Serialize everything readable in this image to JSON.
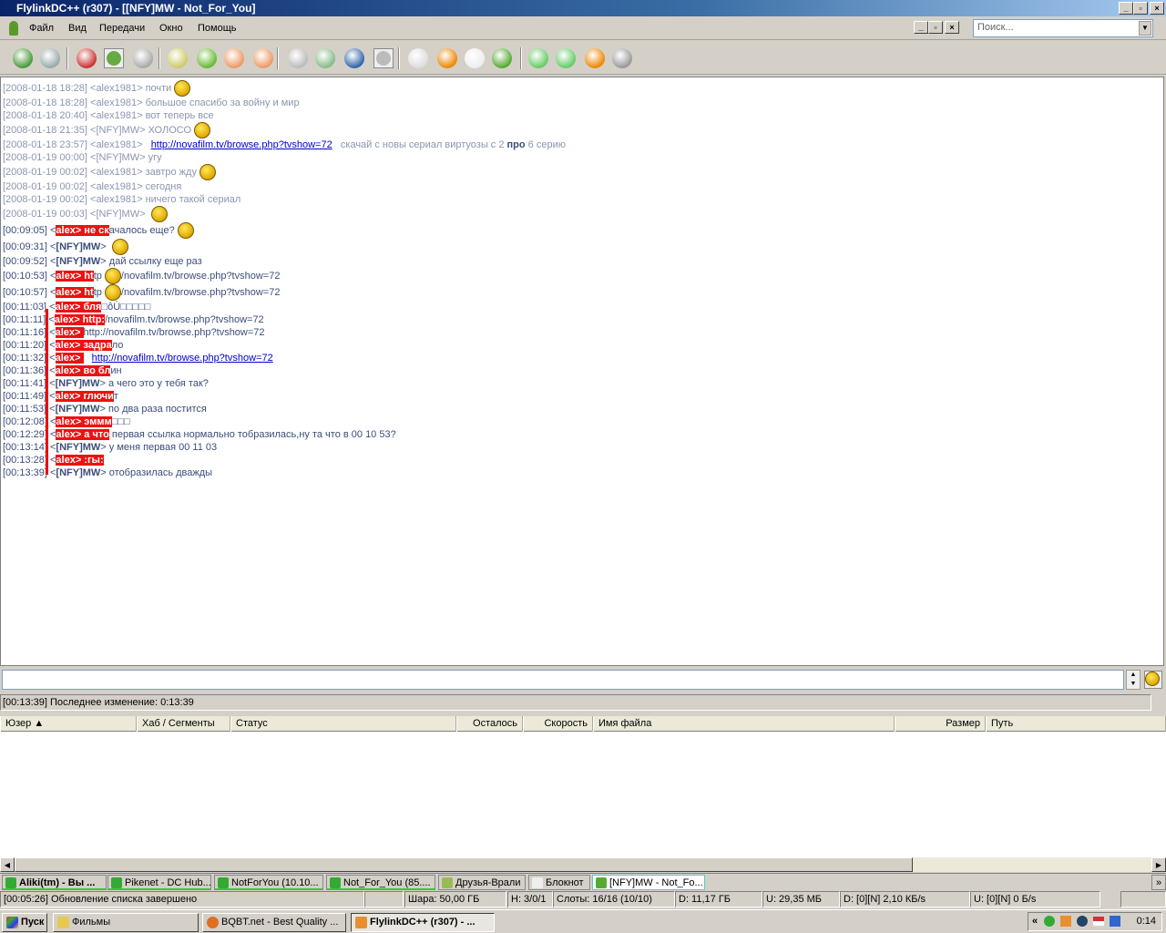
{
  "window": {
    "title": "FlylinkDC++ (r307) - [[NFY]MW - Not_For_You]"
  },
  "menu": [
    "Файл",
    "Вид",
    "Передачи",
    "Окно",
    "Помощь"
  ],
  "search": {
    "placeholder": "Поиск..."
  },
  "toolbar": [
    "reconnect",
    "follow-redirect",
    "favorites",
    "users",
    "recent-hubs",
    "queue",
    "finished-downloads",
    "upload-queue",
    "finished-uploads",
    "search",
    "adl-search",
    "search-spy",
    "notepad",
    "file-list",
    "network-stats",
    "settings",
    "user",
    "power",
    "limiter-80",
    "flylink",
    "sound"
  ],
  "chat": [
    {
      "old": true,
      "segs": [
        {
          "t": "[2008-01-18 18:28] <alex1981> почти"
        },
        {
          "s": 1
        }
      ]
    },
    {
      "old": true,
      "segs": [
        {
          "t": "[2008-01-18 18:28] <alex1981> большое спасибо за войну и мир"
        }
      ]
    },
    {
      "old": true,
      "segs": [
        {
          "t": "[2008-01-18 20:40] <alex1981> вот теперь все"
        }
      ]
    },
    {
      "old": true,
      "segs": [
        {
          "t": "[2008-01-18 21:35] <[NFY]MW> ХОЛОСО"
        },
        {
          "s": 1
        }
      ]
    },
    {
      "old": true,
      "segs": [
        {
          "t": "[2008-01-18 23:57] <alex1981>   "
        },
        {
          "l": "http://novafilm.tv/browse.php?tvshow=72"
        },
        {
          "t": "   скачай с новы сериал виртуозы с 2 "
        },
        {
          "b": "про"
        },
        {
          "t": " 6 серию"
        }
      ]
    },
    {
      "old": true,
      "segs": [
        {
          "t": "[2008-01-19 00:00] <[NFY]MW> угу"
        }
      ]
    },
    {
      "old": true,
      "segs": [
        {
          "t": "[2008-01-19 00:02] <alex1981> завтро жду"
        },
        {
          "s": 1
        }
      ]
    },
    {
      "old": true,
      "segs": [
        {
          "t": "[2008-01-19 00:02] <alex1981> сегодня"
        }
      ]
    },
    {
      "old": true,
      "segs": [
        {
          "t": "[2008-01-19 00:02] <alex1981> ничего такой сериал"
        }
      ]
    },
    {
      "old": true,
      "segs": [
        {
          "t": "[2008-01-19 00:03] <[NFY]MW> "
        },
        {
          "s": 1
        }
      ]
    },
    {
      "segs": [
        {
          "t": "[00:09:05] <"
        },
        {
          "h": "alex> не ск"
        },
        {
          "t": "ачалось еще?"
        },
        {
          "s": 1
        }
      ]
    },
    {
      "segs": [
        {
          "t": "[00:09:31] <"
        },
        {
          "b": "[NFY]MW"
        },
        {
          "t": "> "
        },
        {
          "s": 1
        }
      ]
    },
    {
      "segs": [
        {
          "t": "[00:09:52] <"
        },
        {
          "b": "[NFY]MW"
        },
        {
          "t": "> дай ссылку еще раз"
        }
      ]
    },
    {
      "segs": [
        {
          "t": "[00:10:53] <"
        },
        {
          "h": "alex>    ht"
        },
        {
          "t": "tp"
        },
        {
          "s": 1
        },
        {
          "t": "/novafilm.tv/browse.php?tvshow=72"
        }
      ]
    },
    {
      "segs": [
        {
          "t": "[00:10:57] <"
        },
        {
          "h": "alex>     ht"
        },
        {
          "t": "tp"
        },
        {
          "s": 1
        },
        {
          "t": "/novafilm.tv/browse.php?tvshow=72"
        }
      ]
    },
    {
      "segs": [
        {
          "t": "[00:11:03] <"
        },
        {
          "h": "alex> бля"
        },
        {
          "t": "□ôÙ□□□□□"
        }
      ]
    },
    {
      "segs": [
        {
          "t": "[00:11:11] <"
        },
        {
          "h": "alex> http:"
        },
        {
          "t": "/novafilm.tv/browse.php?tvshow=72"
        }
      ]
    },
    {
      "segs": [
        {
          "t": "[00:11:16] <"
        },
        {
          "h": "alex>       "
        },
        {
          "t": "http://novafilm.tv/browse.php?tvshow=72"
        }
      ]
    },
    {
      "segs": [
        {
          "t": "[00:11:20] <"
        },
        {
          "h": "alex> задра"
        },
        {
          "t": "ло"
        }
      ]
    },
    {
      "segs": [
        {
          "t": "[00:11:32] <"
        },
        {
          "h": "alex>       "
        },
        {
          "t": "   "
        },
        {
          "l": "http://novafilm.tv/browse.php?tvshow=72"
        }
      ]
    },
    {
      "segs": [
        {
          "t": "[00:11:36] <"
        },
        {
          "h": "alex> во бл"
        },
        {
          "t": "ин"
        }
      ]
    },
    {
      "segs": [
        {
          "t": "[00:11:41] <"
        },
        {
          "b": "[NFY]MW"
        },
        {
          "t": "> а чего это у тебя так?"
        }
      ]
    },
    {
      "segs": [
        {
          "t": "[00:11:49] <"
        },
        {
          "h": "alex> глючи"
        },
        {
          "t": "т"
        }
      ]
    },
    {
      "segs": [
        {
          "t": "[00:11:53] <"
        },
        {
          "b": "[NFY]MW"
        },
        {
          "t": "> по два раза постится"
        }
      ]
    },
    {
      "segs": [
        {
          "t": "[00:12:08] <"
        },
        {
          "h": "alex> эммм"
        },
        {
          "t": "□□□"
        }
      ]
    },
    {
      "segs": [
        {
          "t": "[00:12:29] <"
        },
        {
          "h": "alex> а что"
        },
        {
          "t": " первая ссылка нормально тобразилась,ну та что в 00 10 53?"
        }
      ]
    },
    {
      "segs": [
        {
          "t": "[00:13:14] <"
        },
        {
          "b": "[NFY]MW"
        },
        {
          "t": "> у меня первая 00 11 03"
        }
      ]
    },
    {
      "segs": [
        {
          "t": "[00:13:28] <"
        },
        {
          "h": "alex> :гы:"
        }
      ]
    },
    {
      "segs": [
        {
          "t": "[00:13:39] <"
        },
        {
          "b": "[NFY]MW"
        },
        {
          "t": "> отобразилась дважды"
        }
      ]
    }
  ],
  "last_status": "[00:13:39] Последнее изменение: 0:13:39",
  "columns": [
    "Юзер",
    "Хаб / Сегменты",
    "Статус",
    "Осталось",
    "Скорость",
    "Имя файла",
    "Размер",
    "Путь"
  ],
  "tabs": [
    "Aliki(tm) - Вы ...",
    "Pikenet - DC Hub...",
    "NotForYou (10.10...",
    "Not_For_You (85....",
    "Друзья-Врали",
    "Блокнот",
    "[NFY]MW - Not_Fo..."
  ],
  "status": [
    "[00:05:26] Обновление списка завершено",
    "",
    "Шара: 50,00 ГБ",
    "H: 3/0/1",
    "Слоты: 16/16 (10/10)",
    "D: 11,17 ГБ",
    "U: 29,35 МБ",
    "D: [0][N] 2,10 КБ/s",
    "U: [0][N] 0 Б/s",
    ""
  ],
  "taskbar": {
    "start": "Пуск",
    "items": [
      "Фильмы",
      "BQBT.net - Best Quality ...",
      "FlylinkDC++ (r307) - ..."
    ],
    "clock": "0:14"
  },
  "colors": {
    "highlight": "#ee1111",
    "link": "#0000cc",
    "title": "#0a246a"
  }
}
